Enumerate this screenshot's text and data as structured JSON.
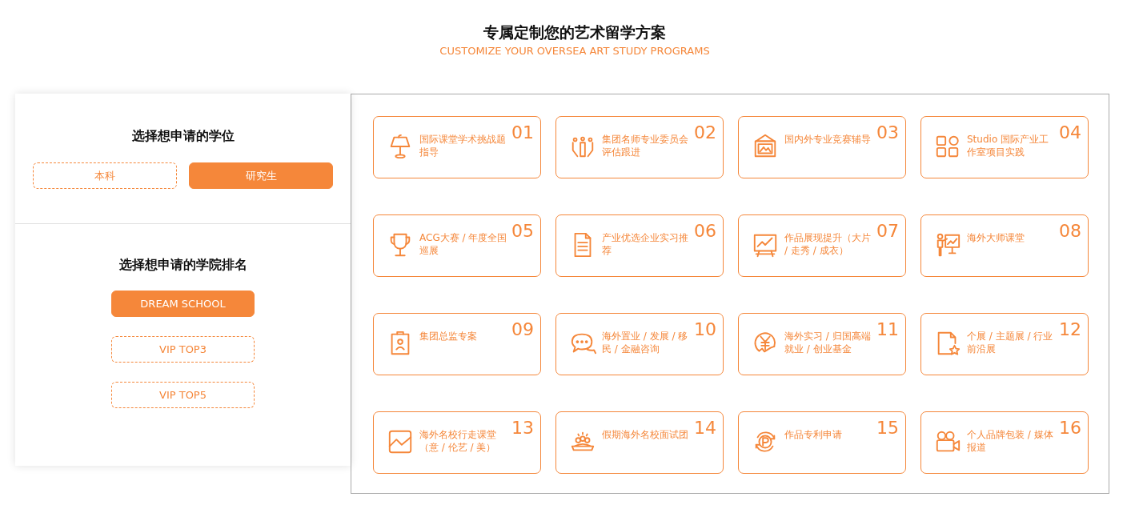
{
  "header": {
    "title": "专属定制您的艺术留学方案",
    "subtitle": "CUSTOMIZE YOUR OVERSEA ART STUDY PROGRAMS"
  },
  "degree": {
    "heading": "选择想申请的学位",
    "options": [
      {
        "label": "本科",
        "selected": false
      },
      {
        "label": "研究生",
        "selected": true
      }
    ]
  },
  "ranking": {
    "heading": "选择想申请的学院排名",
    "options": [
      {
        "label": "DREAM SCHOOL",
        "selected": true
      },
      {
        "label": "VIP TOP3",
        "selected": false
      },
      {
        "label": "VIP TOP5",
        "selected": false
      }
    ]
  },
  "services": [
    {
      "number": "01",
      "text": "国际课堂学术挑战题指导"
    },
    {
      "number": "02",
      "text": "集团名师专业委员会评估跟进"
    },
    {
      "number": "03",
      "text": "国内外专业竞赛辅导"
    },
    {
      "number": "04",
      "text": "Studio 国际产业工作室项目实践"
    },
    {
      "number": "05",
      "text": "ACG大赛 / 年度全国巡展"
    },
    {
      "number": "06",
      "text": "产业优选企业实习推荐"
    },
    {
      "number": "07",
      "text": "作品展现提升（大片 / 走秀 / 成衣）"
    },
    {
      "number": "08",
      "text": "海外大师课堂"
    },
    {
      "number": "09",
      "text": "集团总监专案"
    },
    {
      "number": "10",
      "text": "海外置业 / 发展 / 移民 / 金融咨询"
    },
    {
      "number": "11",
      "text": "海外实习 / 归国高端就业 / 创业基金"
    },
    {
      "number": "12",
      "text": "个展 / 主题展 / 行业前沿展"
    },
    {
      "number": "13",
      "text": "海外名校行走课堂（意 / 伦艺 / 美）"
    },
    {
      "number": "14",
      "text": "假期海外名校面试团"
    },
    {
      "number": "15",
      "text": "作品专利申请"
    },
    {
      "number": "16",
      "text": "个人品牌包装 / 媒体报道"
    }
  ]
}
